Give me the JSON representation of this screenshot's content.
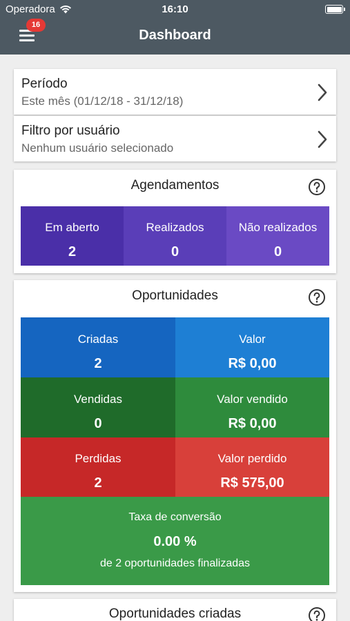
{
  "status_bar": {
    "carrier": "Operadora",
    "time": "16:10"
  },
  "header": {
    "title": "Dashboard",
    "notification_count": "16"
  },
  "periodo": {
    "label": "Período",
    "value": "Este mês (01/12/18 - 31/12/18)"
  },
  "filtro": {
    "label": "Filtro por usuário",
    "value": "Nenhum usuário selecionado"
  },
  "agendamentos": {
    "title": "Agendamentos",
    "tiles": [
      {
        "label": "Em aberto",
        "value": "2",
        "color": "#4a2fa8"
      },
      {
        "label": "Realizados",
        "value": "0",
        "color": "#5a3eb8"
      },
      {
        "label": "Não realizados",
        "value": "0",
        "color": "#6a4ac4"
      }
    ]
  },
  "oportunidades": {
    "title": "Oportunidades",
    "criadas": {
      "label": "Criadas",
      "value": "2",
      "color": "#1565c0"
    },
    "valor": {
      "label": "Valor",
      "value": "R$ 0,00",
      "color": "#1e7fd4"
    },
    "vendidas": {
      "label": "Vendidas",
      "value": "0",
      "color": "#1f6b2a"
    },
    "valor_vendido": {
      "label": "Valor vendido",
      "value": "R$ 0,00",
      "color": "#2e8b3c"
    },
    "perdidas": {
      "label": "Perdidas",
      "value": "2",
      "color": "#c62828"
    },
    "valor_perdido": {
      "label": "Valor perdido",
      "value": "R$ 575,00",
      "color": "#d8403a"
    },
    "conversao": {
      "label": "Taxa de conversão",
      "value": "0.00 %",
      "sub": "de 2 oportunidades finalizadas",
      "color": "#3a9a48"
    }
  },
  "oportunidades_criadas": {
    "title": "Oportunidades criadas"
  }
}
